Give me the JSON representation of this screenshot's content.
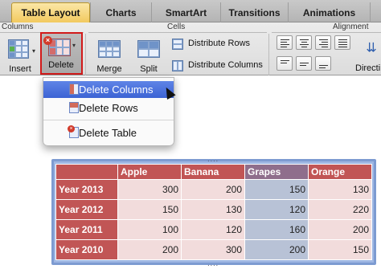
{
  "tabs": [
    {
      "label": "Table Layout",
      "active": true
    },
    {
      "label": "Charts",
      "active": false
    },
    {
      "label": "SmartArt",
      "active": false
    },
    {
      "label": "Transitions",
      "active": false
    },
    {
      "label": "Animations",
      "active": false
    }
  ],
  "ribbon": {
    "groups": {
      "columns": "Columns",
      "cells": "Cells",
      "alignment": "Alignment"
    },
    "insert_label": "Insert",
    "delete_label": "Delete",
    "merge_label": "Merge",
    "split_label": "Split",
    "distribute_rows": "Distribute Rows",
    "distribute_columns": "Distribute Columns",
    "direction_label": "Directi"
  },
  "menu": {
    "items": [
      "Delete Columns",
      "Delete Rows",
      "Delete Table"
    ],
    "highlighted": "Delete Columns"
  },
  "table": {
    "headers": [
      "",
      "Apple",
      "Banana",
      "Grapes",
      "Orange"
    ],
    "rows": [
      {
        "label": "Year 2013",
        "values": [
          "300",
          "200",
          "150",
          "130"
        ]
      },
      {
        "label": "Year 2012",
        "values": [
          "150",
          "130",
          "120",
          "220"
        ]
      },
      {
        "label": "Year 2011",
        "values": [
          "100",
          "120",
          "160",
          "200"
        ]
      },
      {
        "label": "Year 2010",
        "values": [
          "200",
          "300",
          "200",
          "150"
        ]
      }
    ],
    "selected_column": "Grapes"
  },
  "colors": {
    "header_red": "#c15555",
    "cell_pink": "#f2dcdc",
    "selected_col": "#b8c2d6",
    "highlight_blue": "#3c63d4",
    "delete_outline": "#d21a1a"
  }
}
